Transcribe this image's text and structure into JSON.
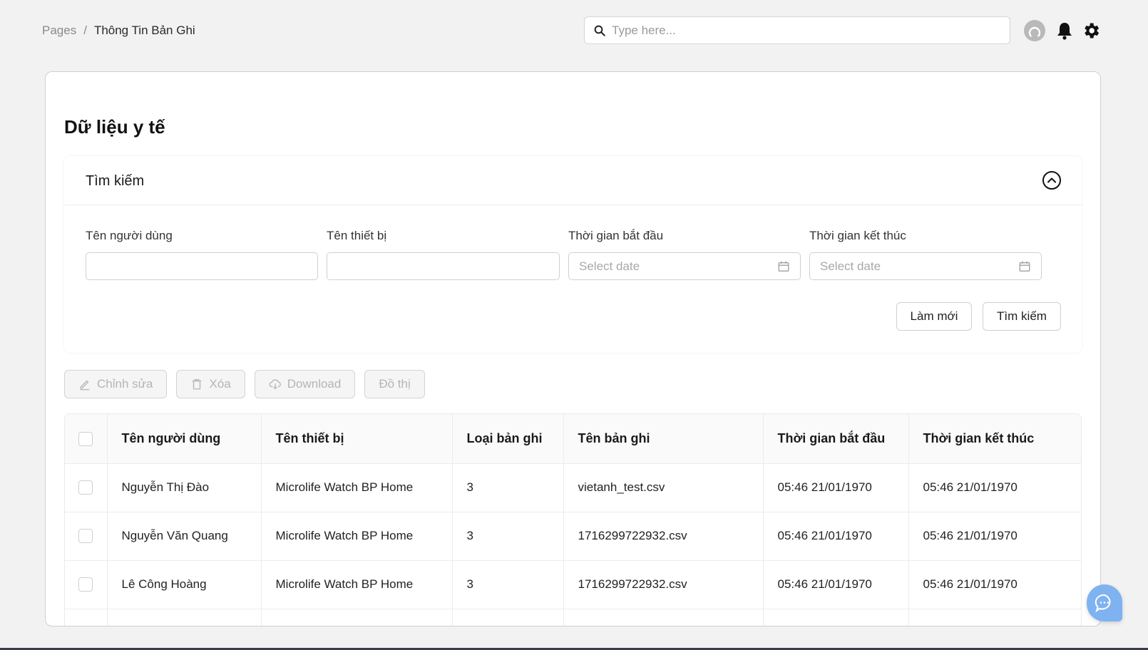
{
  "breadcrumb": {
    "root": "Pages",
    "separator": "/",
    "current": "Thông Tin Bản Ghi"
  },
  "search": {
    "placeholder": "Type here..."
  },
  "page": {
    "title": "Dữ liệu y tế"
  },
  "search_panel": {
    "title": "Tìm kiếm",
    "fields": {
      "user_name": {
        "label": "Tên người dùng",
        "value": "",
        "placeholder": ""
      },
      "device_name": {
        "label": "Tên thiết bị",
        "value": "",
        "placeholder": ""
      },
      "start_time": {
        "label": "Thời gian bắt đầu",
        "placeholder": "Select date"
      },
      "end_time": {
        "label": "Thời gian kết thúc",
        "placeholder": "Select date"
      }
    },
    "reset_label": "Làm mới",
    "search_label": "Tìm kiếm"
  },
  "toolbar": {
    "edit_label": "Chỉnh sửa",
    "delete_label": "Xóa",
    "download_label": "Download",
    "chart_label": "Đồ thị"
  },
  "table": {
    "headers": [
      "Tên người dùng",
      "Tên thiết bị",
      "Loại bản ghi",
      "Tên bản ghi",
      "Thời gian bắt đầu",
      "Thời gian kết thúc"
    ],
    "rows": [
      [
        "Nguyễn Thị Đào",
        "Microlife Watch BP Home",
        "3",
        "vietanh_test.csv",
        "05:46 21/01/1970",
        "05:46 21/01/1970"
      ],
      [
        "Nguyễn Văn Quang",
        "Microlife Watch BP Home",
        "3",
        "1716299722932.csv",
        "05:46 21/01/1970",
        "05:46 21/01/1970"
      ],
      [
        "Lê Công Hoàng",
        "Microlife Watch BP Home",
        "3",
        "1716299722932.csv",
        "05:46 21/01/1970",
        "05:46 21/01/1970"
      ]
    ]
  },
  "icons": {
    "search": "search-icon",
    "avatar": "user-avatar-icon",
    "bell": "bell-icon",
    "gear": "gear-icon",
    "collapse": "chevron-up-circle-icon",
    "calendar": "calendar-icon",
    "edit": "pencil-icon",
    "delete": "trash-icon",
    "download": "cloud-download-icon",
    "chat": "chat-bubble-icon"
  },
  "colors": {
    "background": "#f2f2f2",
    "card": "#ffffff",
    "disabled_text": "#b5b5b5",
    "chat_accent": "#7fb2f0"
  }
}
